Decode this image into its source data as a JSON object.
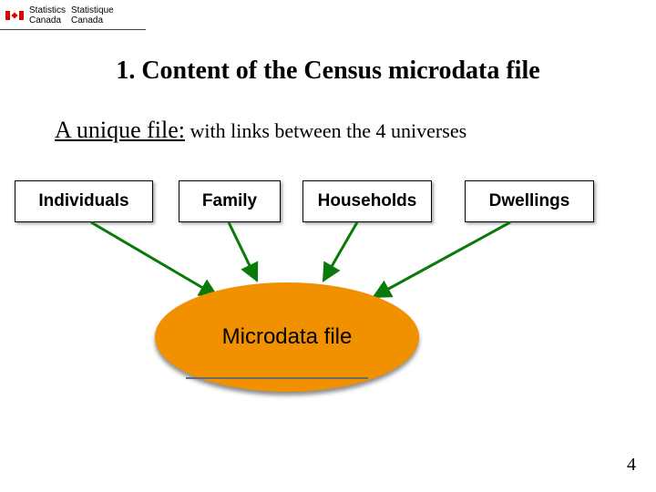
{
  "logo": {
    "org_en_line1": "Statistics",
    "org_en_line2": "Canada",
    "org_fr_line1": "Statistique",
    "org_fr_line2": "Canada"
  },
  "title": "1. Content of the Census microdata file",
  "subtitle_lead": "A unique file:",
  "subtitle_rest": " with links between the 4 universes",
  "boxes": {
    "b1": "Individuals",
    "b2": "Family",
    "b3": "Households",
    "b4": "Dwellings"
  },
  "ellipse_label": "Microdata file",
  "page_number": "4",
  "colors": {
    "accent": "#f29100",
    "arrow": "#0a7a0a"
  }
}
